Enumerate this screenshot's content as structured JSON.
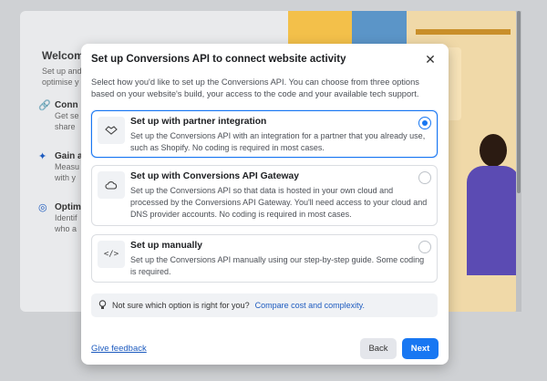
{
  "background": {
    "title": "Welcome",
    "subtitle_lines": [
      "Set up and",
      "optimise y"
    ],
    "rows": [
      {
        "icon": "link-icon",
        "title": "Conn",
        "lines": [
          "Get se",
          "share"
        ]
      },
      {
        "icon": "spark-icon",
        "title": "Gain a",
        "lines": [
          "Measu",
          "with y"
        ]
      },
      {
        "icon": "target-icon",
        "title": "Optim",
        "lines": [
          "Identif",
          "who a"
        ]
      }
    ]
  },
  "modal": {
    "title": "Set up Conversions API to connect website activity",
    "description": "Select how you'd like to set up the Conversions API. You can choose from three options based on your website's build, your access to the code and your available tech support.",
    "options": [
      {
        "icon": "handshake-icon",
        "title": "Set up with partner integration",
        "description": "Set up the Conversions API with an integration for a partner that you already use, such as Shopify. No coding is required in most cases.",
        "selected": true
      },
      {
        "icon": "cloud-icon",
        "title": "Set up with Conversions API Gateway",
        "description": "Set up the Conversions API so that data is hosted in your own cloud and processed by the Conversions API Gateway. You'll need access to your cloud and DNS provider accounts. No coding is required in most cases.",
        "selected": false
      },
      {
        "icon": "code-icon",
        "title": "Set up manually",
        "description": "Set up the Conversions API manually using our step-by-step guide. Some coding is required.",
        "selected": false
      }
    ],
    "tip": {
      "text": "Not sure which option is right for you?",
      "link": "Compare cost and complexity."
    },
    "footer": {
      "feedback_link": "Give feedback",
      "back_label": "Back",
      "next_label": "Next"
    }
  },
  "colors": {
    "accent": "#1877f2",
    "link": "#1d5bbf"
  }
}
